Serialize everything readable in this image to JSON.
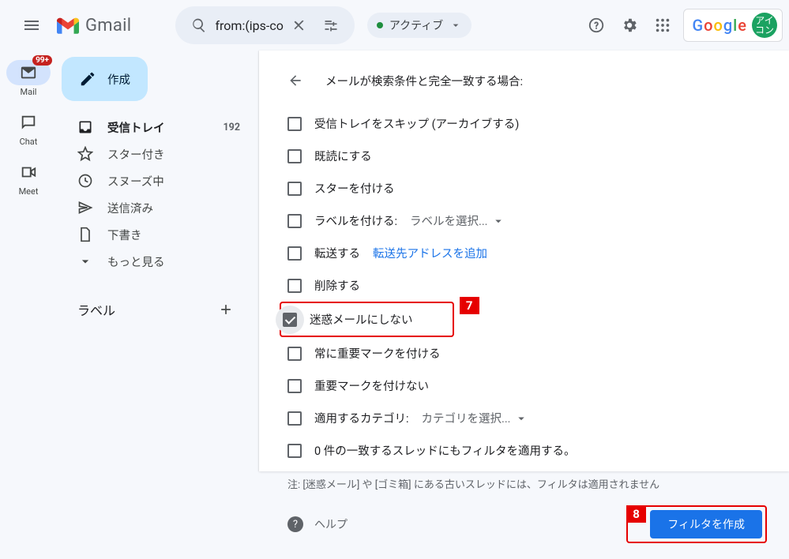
{
  "header": {
    "product_name": "Gmail",
    "search_query": "from:(ips-co",
    "status_chip_label": "アクティブ",
    "avatar_text": "アイ\nコン"
  },
  "rail": {
    "items": [
      {
        "key": "mail",
        "label": "Mail",
        "badge": "99+",
        "active": true
      },
      {
        "key": "chat",
        "label": "Chat"
      },
      {
        "key": "meet",
        "label": "Meet"
      }
    ]
  },
  "sidebar": {
    "compose_label": "作成",
    "items": [
      {
        "key": "inbox",
        "label": "受信トレイ",
        "count": "192",
        "bold": true
      },
      {
        "key": "starred",
        "label": "スター付き"
      },
      {
        "key": "snoozed",
        "label": "スヌーズ中"
      },
      {
        "key": "sent",
        "label": "送信済み"
      },
      {
        "key": "drafts",
        "label": "下書き"
      },
      {
        "key": "more",
        "label": "もっと見る"
      }
    ],
    "labels_heading": "ラベル"
  },
  "filter_panel": {
    "title": "メールが検索条件と完全一致する場合:",
    "options": {
      "skip_inbox": "受信トレイをスキップ (アーカイブする)",
      "mark_read": "既読にする",
      "star_it": "スターを付ける",
      "apply_label": "ラベルを付ける:",
      "apply_label_sel": "ラベルを選択...",
      "forward": "転送する",
      "forward_link": "転送先アドレスを追加",
      "delete": "削除する",
      "not_spam": "迷惑メールにしない",
      "always_important": "常に重要マークを付ける",
      "never_important": "重要マークを付けない",
      "categorize": "適用するカテゴリ:",
      "categorize_sel": "カテゴリを選択...",
      "apply_existing": "0 件の一致するスレッドにもフィルタを適用する。"
    },
    "note": "注: [迷惑メール] や [ゴミ箱] にある古いスレッドには、フィルタは適用されません",
    "help_label": "ヘルプ",
    "create_button": "フィルタを作成"
  },
  "callouts": {
    "seven": "7",
    "eight": "8"
  }
}
